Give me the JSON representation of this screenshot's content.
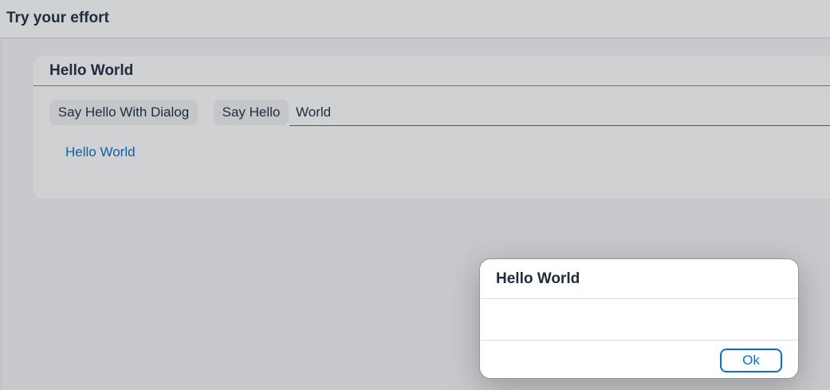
{
  "page": {
    "title": "Try your effort"
  },
  "panel": {
    "title": "Hello World",
    "say_hello_dialog_label": "Say Hello With Dialog",
    "say_hello_label": "Say Hello",
    "name_input_value": "World",
    "output_text": "Hello World"
  },
  "dialog": {
    "title": "Hello World",
    "content": "",
    "ok_label": "Ok"
  },
  "colors": {
    "brand_blue": "#0a6ed1",
    "text_dark": "#1d2d3e",
    "page_bg": "#f4f5f6"
  }
}
